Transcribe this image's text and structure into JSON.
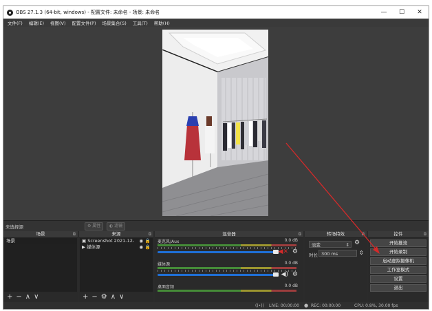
{
  "window": {
    "title": "OBS 27.1.3 (64-bit, windows) - 配置文件: 未命名 - 场景: 未命名",
    "controls": {
      "minimize": "—",
      "maximize": "☐",
      "close": "✕"
    }
  },
  "menu": [
    "文件(F)",
    "编辑(E)",
    "视图(V)",
    "配置文件(P)",
    "场景集合(S)",
    "工具(T)",
    "帮助(H)"
  ],
  "status": {
    "no_source": "未选择源",
    "properties": "属性",
    "filters": "滤镜"
  },
  "scenes": {
    "title": "场景",
    "items": [
      "场景"
    ],
    "footer_icons": [
      "add-icon",
      "remove-icon",
      "up-icon",
      "down-icon"
    ]
  },
  "sources": {
    "title": "来源",
    "items": [
      {
        "name": "Screenshot 2021-12-",
        "icon": "monitor-icon"
      },
      {
        "name": "媒体源",
        "icon": "play-icon"
      }
    ]
  },
  "mixer": {
    "title": "混音器",
    "channels": [
      {
        "name": "麦克风/Aux",
        "db": "0.0 dB",
        "muted": true,
        "volume": 1.0
      },
      {
        "name": "媒体源",
        "db": "0.0 dB",
        "muted": false,
        "volume": 1.0
      },
      {
        "name": "桌面音频",
        "db": "0.0 dB",
        "muted": false,
        "volume": 1.0
      }
    ]
  },
  "transitions": {
    "title": "转场特效",
    "selected": "淡变",
    "duration_label": "时长",
    "duration_value": "300 ms"
  },
  "controls": {
    "title": "控件",
    "buttons": [
      "开始推流",
      "开始录制",
      "启动虚拟摄像机",
      "工作室模式",
      "设置",
      "退出"
    ]
  },
  "footer": {
    "live": "LIVE: 00:00:00",
    "rec": "REC: 00:00:00",
    "cpu": "CPU: 0.8%, 30.00 fps"
  },
  "colors": {
    "accent_slider": "#1f6fd6",
    "mute_red": "#d42a2a",
    "annotation_arrow": "#d42a2a"
  }
}
